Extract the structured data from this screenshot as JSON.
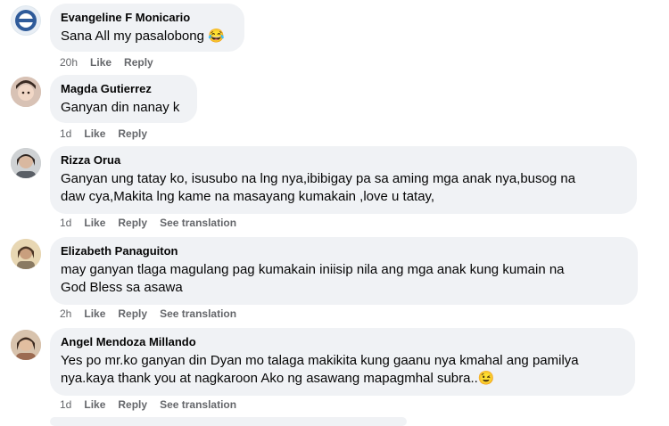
{
  "comments": [
    {
      "author": "Evangeline F Monicario",
      "lines": [
        "Sana All my pasalobong 😂"
      ],
      "time": "20h",
      "like": "Like",
      "reply": "Reply"
    },
    {
      "author": "Magda Gutierrez",
      "lines": [
        "Ganyan din nanay k"
      ],
      "time": "1d",
      "like": "Like",
      "reply": "Reply"
    },
    {
      "author": "Rizza Orua",
      "lines": [
        "Ganyan ung tatay ko, isusubo na lng nya,ibibigay pa sa aming mga anak nya,busog na",
        "daw cya,Makita lng kame na masayang kumakain ,love u tatay,"
      ],
      "time": "1d",
      "like": "Like",
      "reply": "Reply",
      "translate": "See translation"
    },
    {
      "author": "Elizabeth Panaguiton",
      "lines": [
        "may ganyan tlaga magulang pag kumakain iniisip nila ang mga anak kung kumain na",
        "God Bless sa asawa"
      ],
      "time": "2h",
      "like": "Like",
      "reply": "Reply",
      "translate": "See translation"
    },
    {
      "author": "Angel Mendoza Millando",
      "lines": [
        "Yes po mr.ko ganyan din Dyan mo talaga makikita kung gaanu nya kmahal ang pamilya",
        "nya.kaya thank you at nagkaroon Ako ng asawang mapagmhal subra..😉"
      ],
      "time": "1d",
      "like": "Like",
      "reply": "Reply",
      "translate": "See translation"
    }
  ]
}
